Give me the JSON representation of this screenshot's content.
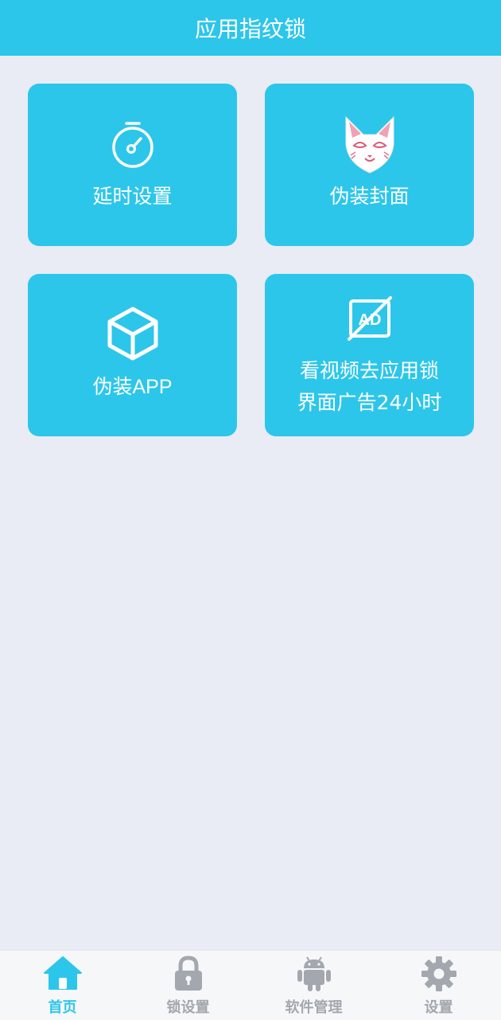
{
  "header": {
    "title": "应用指纹锁"
  },
  "tiles": [
    {
      "label": "延时设置",
      "icon": "stopwatch-icon"
    },
    {
      "label": "伪装封面",
      "icon": "fox-mask-icon"
    },
    {
      "label": "伪装APP",
      "icon": "cube-icon"
    },
    {
      "label": "看视频去应用锁\n界面广告24小时",
      "icon": "no-ads-icon"
    }
  ],
  "tabbar": [
    {
      "label": "首页",
      "icon": "home-icon",
      "active": true
    },
    {
      "label": "锁设置",
      "icon": "lock-icon",
      "active": false
    },
    {
      "label": "软件管理",
      "icon": "android-icon",
      "active": false
    },
    {
      "label": "设置",
      "icon": "gear-icon",
      "active": false
    }
  ],
  "colors": {
    "accent": "#2cc6ea",
    "background": "#e9ecf4",
    "tab_inactive": "#a3a7ae"
  }
}
